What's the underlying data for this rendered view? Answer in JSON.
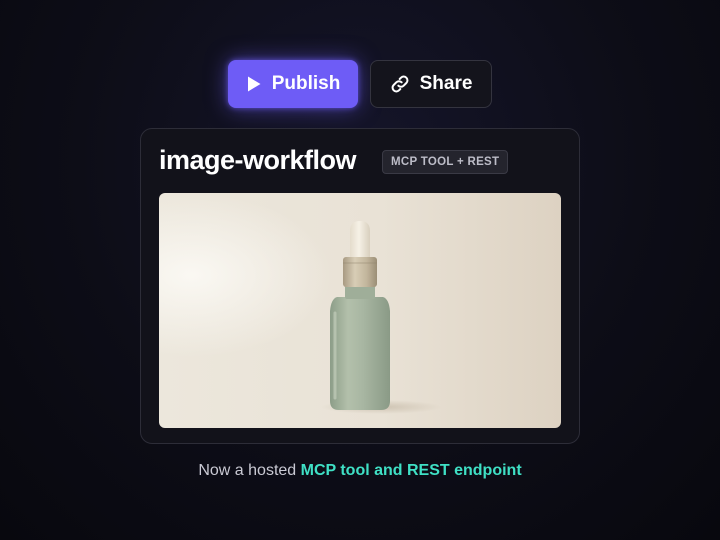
{
  "actions": {
    "publish_label": "Publish",
    "publish_icon": "play-icon",
    "share_label": "Share",
    "share_icon": "link-icon"
  },
  "card": {
    "title": "image-workflow",
    "badge": "MCP TOOL + REST",
    "image_description_icon": "product-photo"
  },
  "caption": {
    "prefix": "Now a hosted ",
    "highlight": "MCP tool and REST endpoint"
  },
  "colors": {
    "accent": "#6e5cf6",
    "highlight": "#3fe0c5",
    "background": "#0c0c14"
  }
}
